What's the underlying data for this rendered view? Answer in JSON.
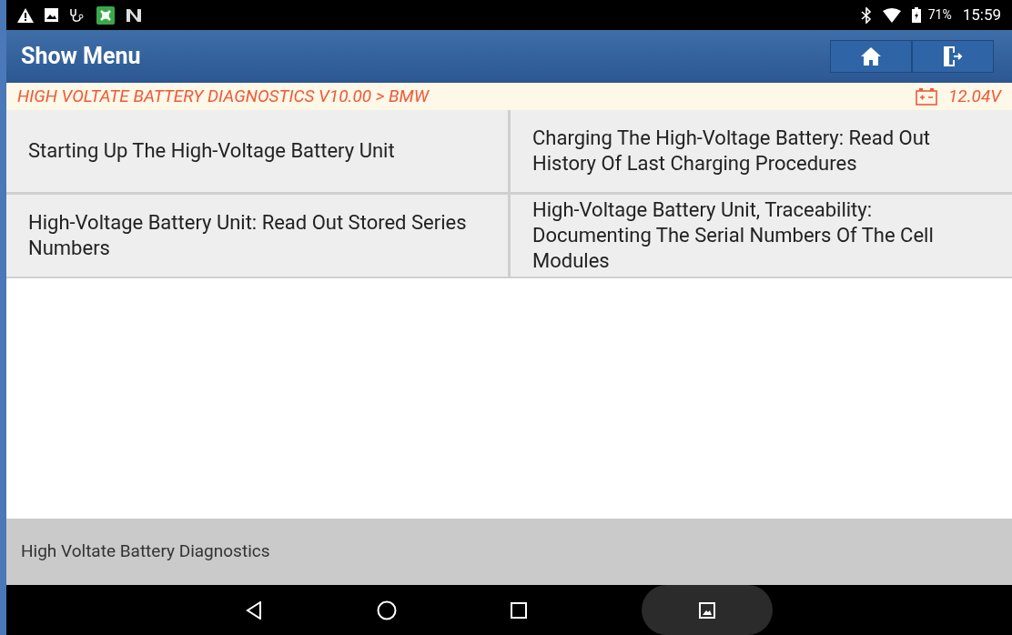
{
  "status_bar": {
    "battery": "71%",
    "time": "15:59"
  },
  "header": {
    "title": "Show Menu"
  },
  "breadcrumb": {
    "path": "HIGH VOLTATE BATTERY DIAGNOSTICS V10.00 > BMW",
    "voltage": "12.04V"
  },
  "menu_items": [
    {
      "label": "Starting Up The High-Voltage Battery Unit"
    },
    {
      "label": "Charging The High-Voltage Battery: Read Out History Of Last Charging Procedures"
    },
    {
      "label": "High-Voltage Battery Unit: Read Out Stored Series Numbers"
    },
    {
      "label": "High-Voltage Battery Unit, Traceability: Documenting The Serial Numbers Of The Cell Modules"
    }
  ],
  "footer": {
    "text": "High Voltate Battery Diagnostics"
  }
}
